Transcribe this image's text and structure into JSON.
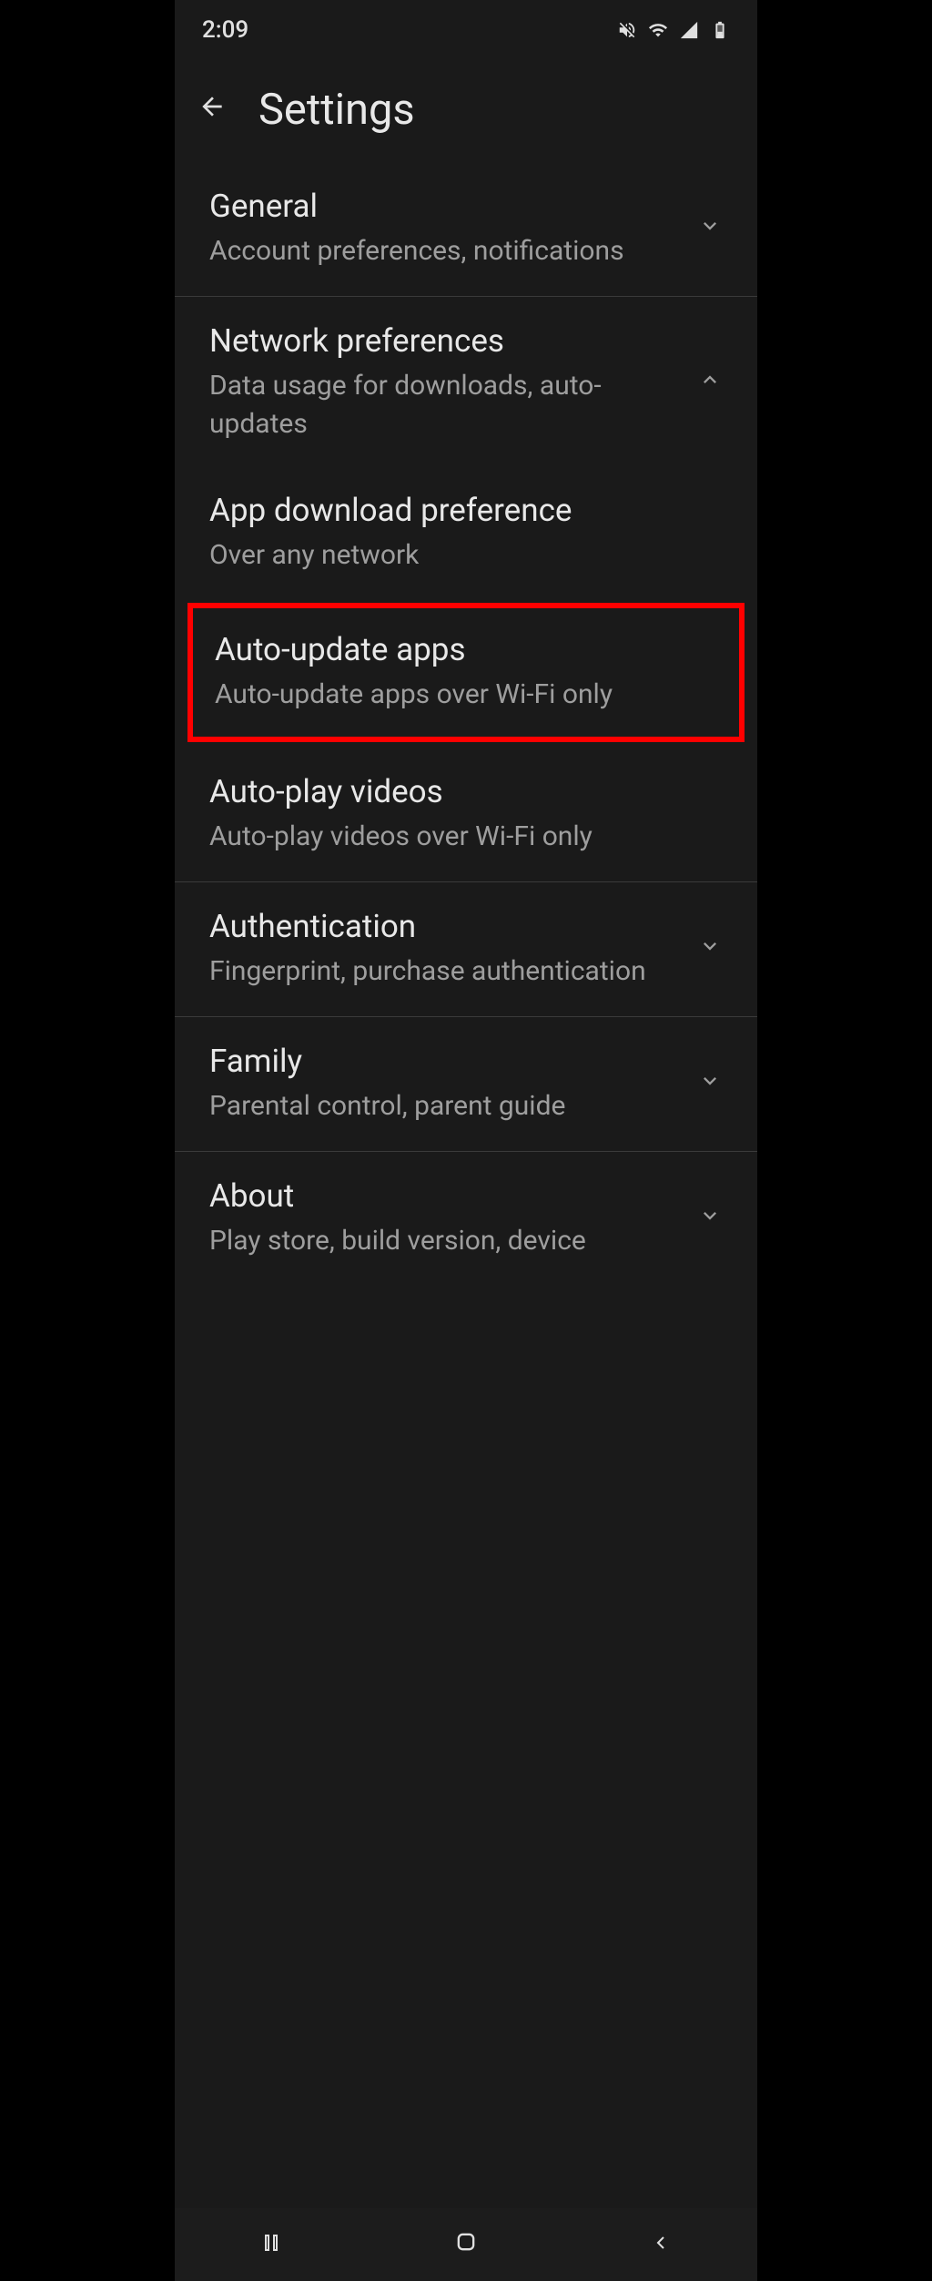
{
  "statusBar": {
    "time": "2:09"
  },
  "header": {
    "title": "Settings"
  },
  "sections": {
    "general": {
      "title": "General",
      "subtitle": "Account preferences, notifications"
    },
    "network": {
      "title": "Network preferences",
      "subtitle": "Data usage for downloads, auto-updates"
    },
    "appDownload": {
      "title": "App download preference",
      "subtitle": "Over any network"
    },
    "autoUpdate": {
      "title": "Auto-update apps",
      "subtitle": "Auto-update apps over Wi-Fi only"
    },
    "autoPlay": {
      "title": "Auto-play videos",
      "subtitle": "Auto-play videos over Wi-Fi only"
    },
    "authentication": {
      "title": "Authentication",
      "subtitle": "Fingerprint, purchase authentication"
    },
    "family": {
      "title": "Family",
      "subtitle": "Parental control, parent guide"
    },
    "about": {
      "title": "About",
      "subtitle": "Play store, build version, device"
    }
  }
}
